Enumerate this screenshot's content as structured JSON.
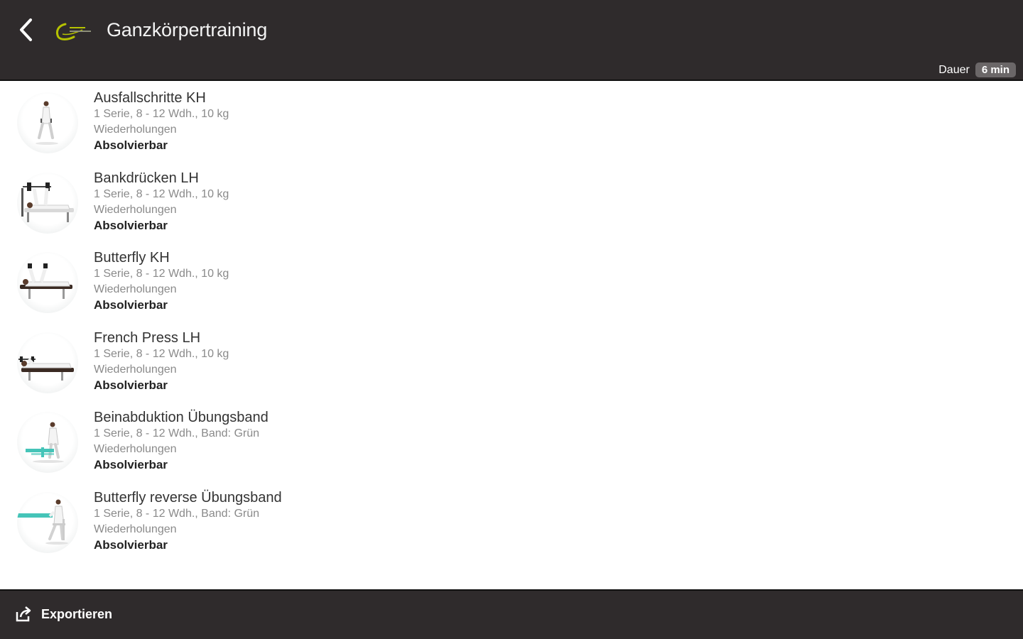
{
  "header": {
    "back_icon": "chevron-left-icon",
    "logo_icon": "gym-logo-icon",
    "title": "Ganzkörpertraining",
    "duration_label": "Dauer",
    "duration_value": "6 min"
  },
  "exercises": [
    {
      "name": "Ausfallschritte KH",
      "detail": "1 Serie, 8 - 12 Wdh., 10 kg",
      "sub": "Wiederholungen",
      "status": "Absolvierbar"
    },
    {
      "name": "Bankdrücken LH",
      "detail": "1 Serie, 8 - 12 Wdh., 10 kg",
      "sub": "Wiederholungen",
      "status": "Absolvierbar"
    },
    {
      "name": "Butterfly KH",
      "detail": "1 Serie, 8 - 12 Wdh., 10 kg",
      "sub": "Wiederholungen",
      "status": "Absolvierbar"
    },
    {
      "name": "French Press LH",
      "detail": "1 Serie, 8 - 12 Wdh., 10 kg",
      "sub": "Wiederholungen",
      "status": "Absolvierbar"
    },
    {
      "name": "Beinabduktion Übungsband",
      "detail": "1 Serie, 8 - 12 Wdh., Band: Grün",
      "sub": "Wiederholungen",
      "status": "Absolvierbar"
    },
    {
      "name": "Butterfly reverse Übungsband",
      "detail": "1 Serie, 8 - 12 Wdh., Band: Grün",
      "sub": "Wiederholungen",
      "status": "Absolvierbar"
    }
  ],
  "footer": {
    "export_icon": "share-export-icon",
    "export_label": "Exportieren"
  },
  "colors": {
    "bar_background": "#2f2b2c",
    "logo_accent": "#b5c200",
    "band_accent": "#45c4b8"
  }
}
